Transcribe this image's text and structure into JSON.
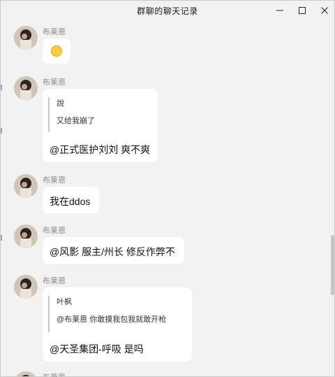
{
  "window": {
    "title": "群聊的聊天记录"
  },
  "controls": {
    "minimize_icon": "minimize-icon",
    "maximize_icon": "maximize-icon",
    "close_icon": "close-icon"
  },
  "messages": [
    {
      "sender": "布莱恩",
      "type": "emoji",
      "emoji_icon": "grimacing-face-emoji-icon"
    },
    {
      "sender": "布莱恩",
      "type": "reply",
      "quote_author": "說",
      "quote_text": "又给我崩了",
      "text": "@正式医护刘刘 爽不爽"
    },
    {
      "sender": "布莱恩",
      "type": "text",
      "text": "我在ddos"
    },
    {
      "sender": "布莱恩",
      "type": "text",
      "text": "@风影 服主/州长 修反作弊不"
    },
    {
      "sender": "布莱恩",
      "type": "reply",
      "quote_author": "叶枫",
      "quote_text": "@布莱恩 你敢摸我包我就敢开枪",
      "text": "@天圣集团-呼吸 是吗"
    },
    {
      "sender": "布莱恩",
      "type": "partial"
    }
  ],
  "colors": {
    "background": "#f2f2f2",
    "bubble": "#ffffff",
    "sender": "#8a8a8a",
    "quote_bar": "#c8c8c8",
    "scroll_thumb": "#c4c4c4"
  }
}
